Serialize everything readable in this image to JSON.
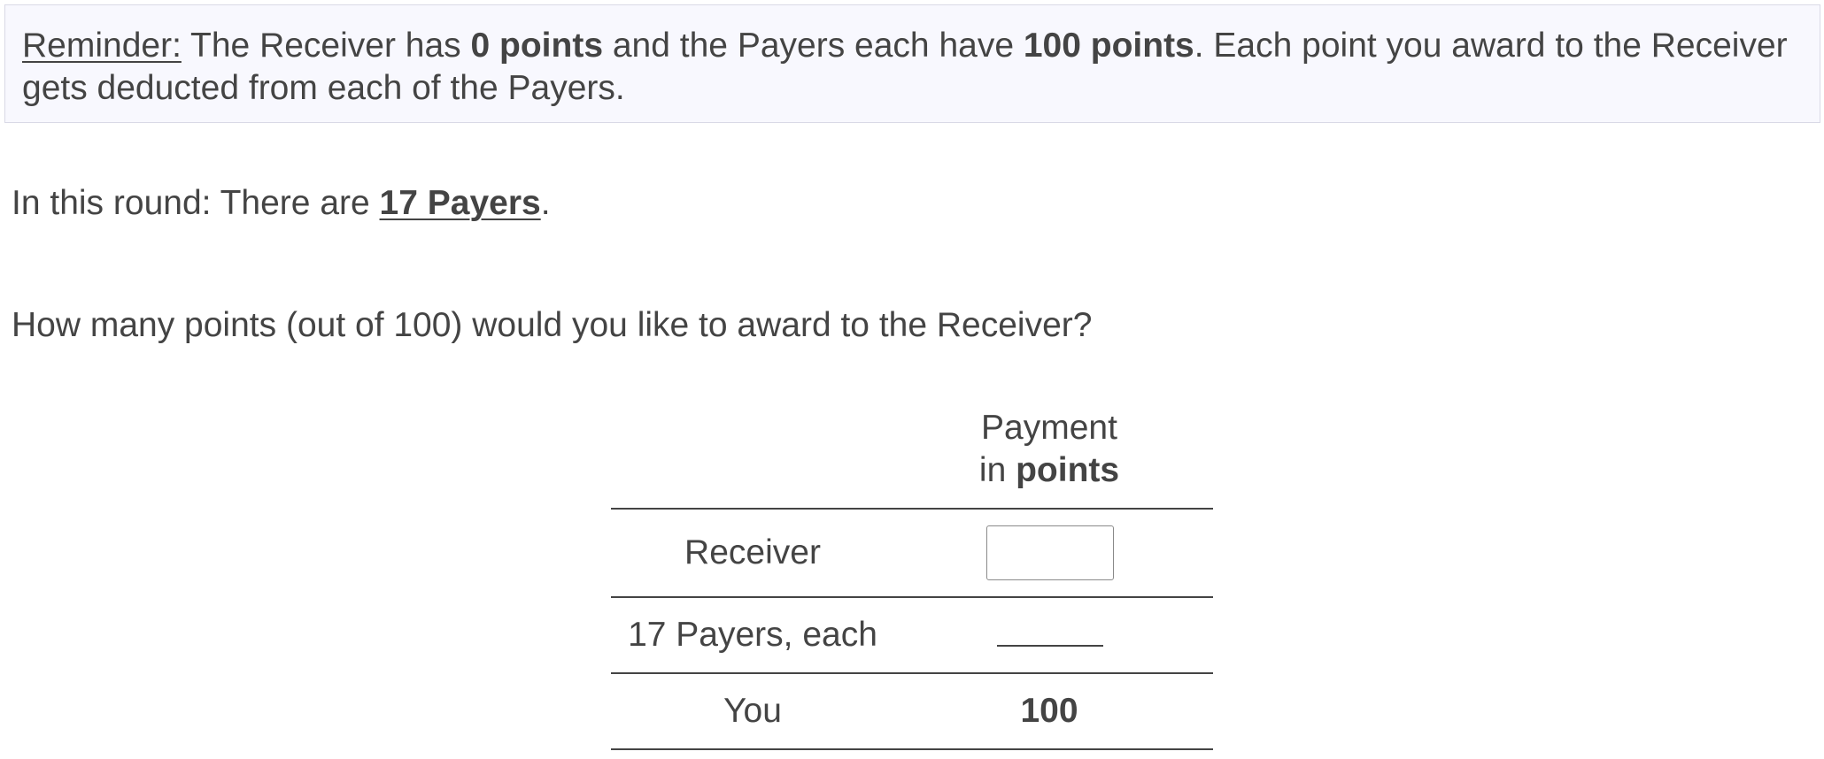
{
  "reminder": {
    "label": "Reminder:",
    "text_1": " The Receiver has ",
    "bold_1": "0 points",
    "text_2": " and the Payers each have ",
    "bold_2": "100 points",
    "text_3": ". Each point you award to the Receiver gets deducted from each of the Payers."
  },
  "round": {
    "prefix": "In this round: There are ",
    "payers_count": "17 Payers",
    "suffix": "."
  },
  "question": "How many points (out of 100) would you like to award to the Receiver?",
  "table": {
    "header_line1": "Payment",
    "header_line2_prefix": "in ",
    "header_line2_bold": "points",
    "rows": {
      "receiver": {
        "label": "Receiver",
        "value": ""
      },
      "payers": {
        "label": "17 Payers, each"
      },
      "you": {
        "label": "You",
        "value": "100"
      }
    }
  },
  "colors": {
    "text": "#444444",
    "reminder_background": "#f8f8fe",
    "reminder_border": "#d9d9e6"
  }
}
